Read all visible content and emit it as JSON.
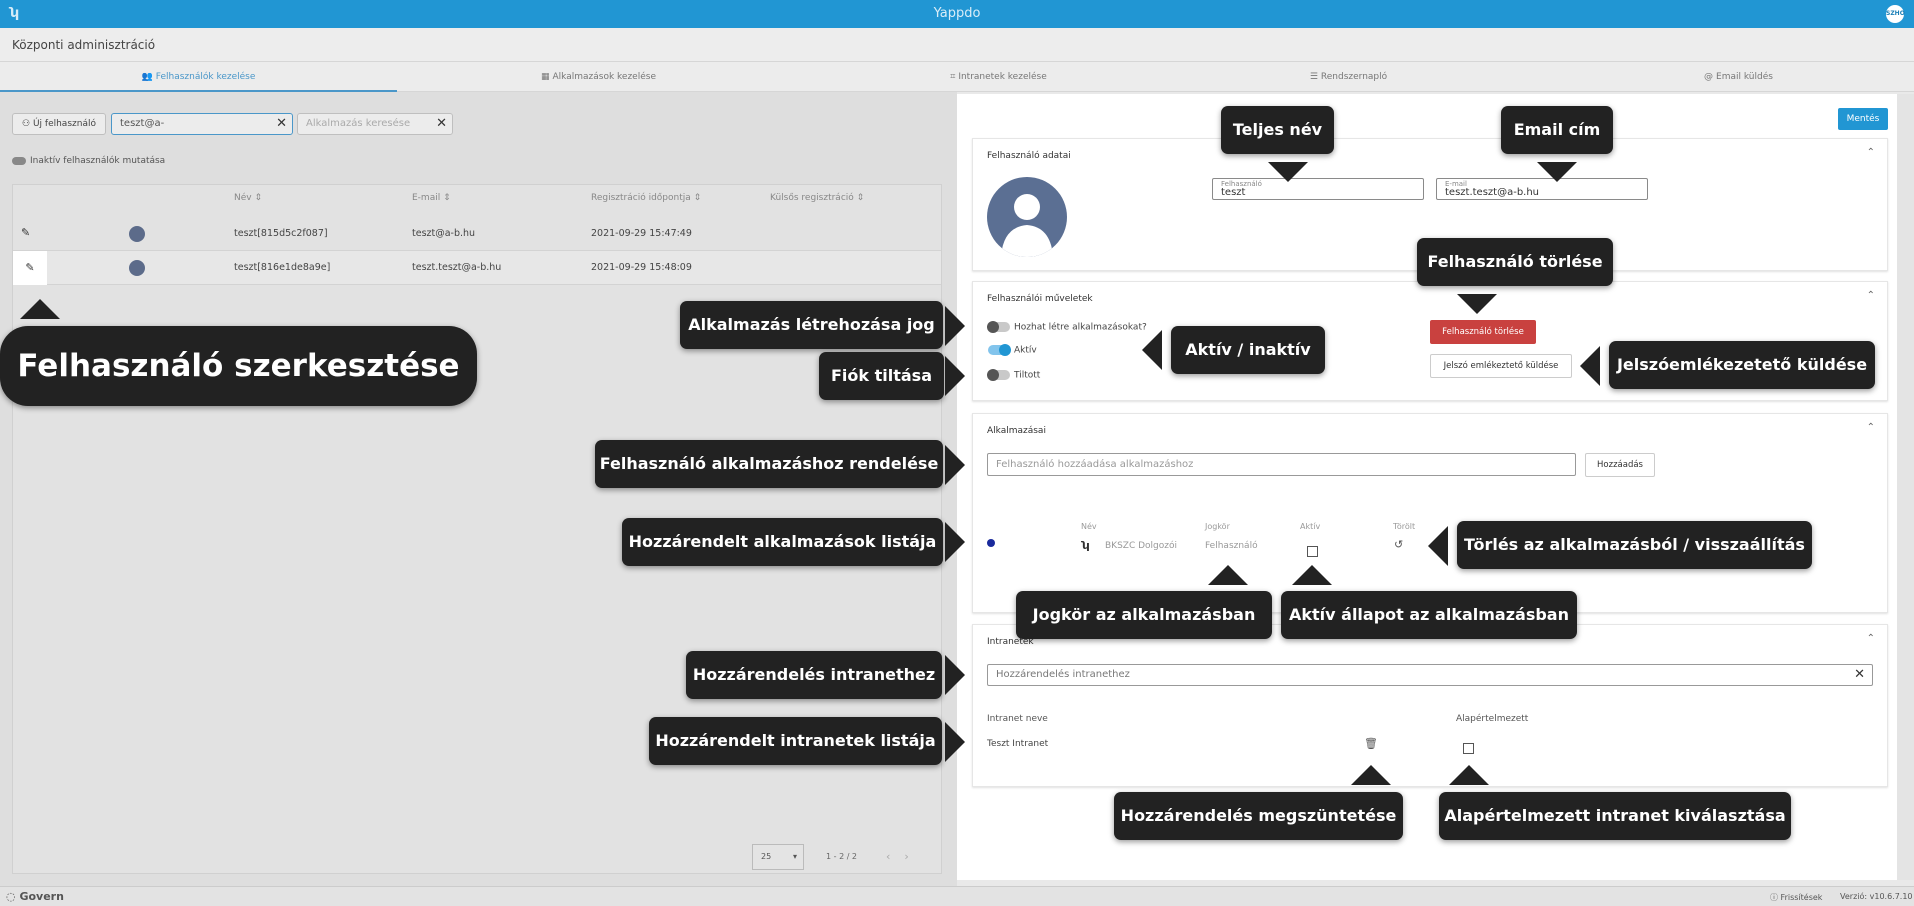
{
  "app": {
    "logo": "ʮ",
    "title": "Yappdo",
    "avatar": "SZHO"
  },
  "subheader": {
    "title": "Központi adminisztráció"
  },
  "tabs": [
    {
      "label": "Felhasználók kezelése",
      "icon": "users-icon"
    },
    {
      "label": "Alkalmazások kezelése",
      "icon": "grid-icon"
    },
    {
      "label": "Intranetek kezelése",
      "icon": "network-icon"
    },
    {
      "label": "Rendszernapló",
      "icon": "list-icon"
    },
    {
      "label": "Email küldés",
      "icon": "at-icon"
    }
  ],
  "left": {
    "new_user": "Új felhasználó",
    "search_value": "teszt@a-",
    "app_search_placeholder": "Alkalmazás keresése",
    "show_inactive": "Inaktív felhasználók mutatása",
    "columns": [
      "Név",
      "E-mail",
      "Regisztráció időpontja",
      "Külsős regisztráció"
    ],
    "rows": [
      {
        "name": "teszt[815d5c2f087]",
        "email": "teszt@a-b.hu",
        "registered": "2021-09-29 15:47:49"
      },
      {
        "name": "teszt[816e1de8a9e]",
        "email": "teszt.teszt@a-b.hu",
        "registered": "2021-09-29 15:48:09"
      }
    ],
    "page_size": "25",
    "page_info": "1 - 2 / 2"
  },
  "dialog": {
    "save": "Mentés",
    "user_data": {
      "header": "Felhasználó adatai",
      "username_label": "Felhasználó",
      "username_value": "teszt",
      "email_label": "E-mail",
      "email_value": "teszt.teszt@a-b.hu"
    },
    "user_ops": {
      "header": "Felhasználói műveletek",
      "can_create_apps": "Hozhat létre alkalmazásokat?",
      "active": "Aktív",
      "banned": "Tiltott",
      "delete_user": "Felhasználó törlése",
      "send_reminder": "Jelszó emlékeztető küldése"
    },
    "apps": {
      "header": "Alkalmazásai",
      "add_placeholder": "Felhasználó hozzáadása alkalmazáshoz",
      "add_button": "Hozzáadás",
      "col_name": "Név",
      "col_role": "Jogkör",
      "col_active": "Aktív",
      "col_deleted": "Törölt",
      "row": {
        "name": "BKSZC Dolgozói",
        "role": "Felhasználó"
      }
    },
    "intranets": {
      "header": "Intranetek",
      "add_placeholder": "Hozzárendelés intranethez",
      "col_name": "Intranet neve",
      "col_default": "Alapértelmezett",
      "row": {
        "name": "Teszt Intranet"
      }
    }
  },
  "footer": {
    "brand": "Govern",
    "refresh": "Frissítések",
    "version": "Verzió: v10.6.7.10"
  },
  "callouts": {
    "edit_user": "Felhasználó szerkesztése",
    "full_name": "Teljes név",
    "email": "Email cím",
    "delete_user": "Felhasználó törlése",
    "app_create_right": "Alkalmazás létrehozása jog",
    "active_inactive": "Aktív / inaktív",
    "ban_account": "Fiók tiltása",
    "send_reminder": "Jelszóemlékezetető küldése",
    "assign_app": "Felhasználó alkalmazáshoz rendelése",
    "assigned_apps": "Hozzárendelt alkalmazások listája",
    "delete_restore": "Törlés az alkalmazásból / visszaállítás",
    "app_role": "Jogkör az alkalmazásban",
    "app_active": "Aktív állapot az alkalmazásban",
    "assign_intranet": "Hozzárendelés intranethez",
    "assigned_intranets": "Hozzárendelt intranetek listája",
    "remove_assignment": "Hozzárendelés megszüntetése",
    "default_intranet": "Alapértelmezett intranet kiválasztása"
  }
}
